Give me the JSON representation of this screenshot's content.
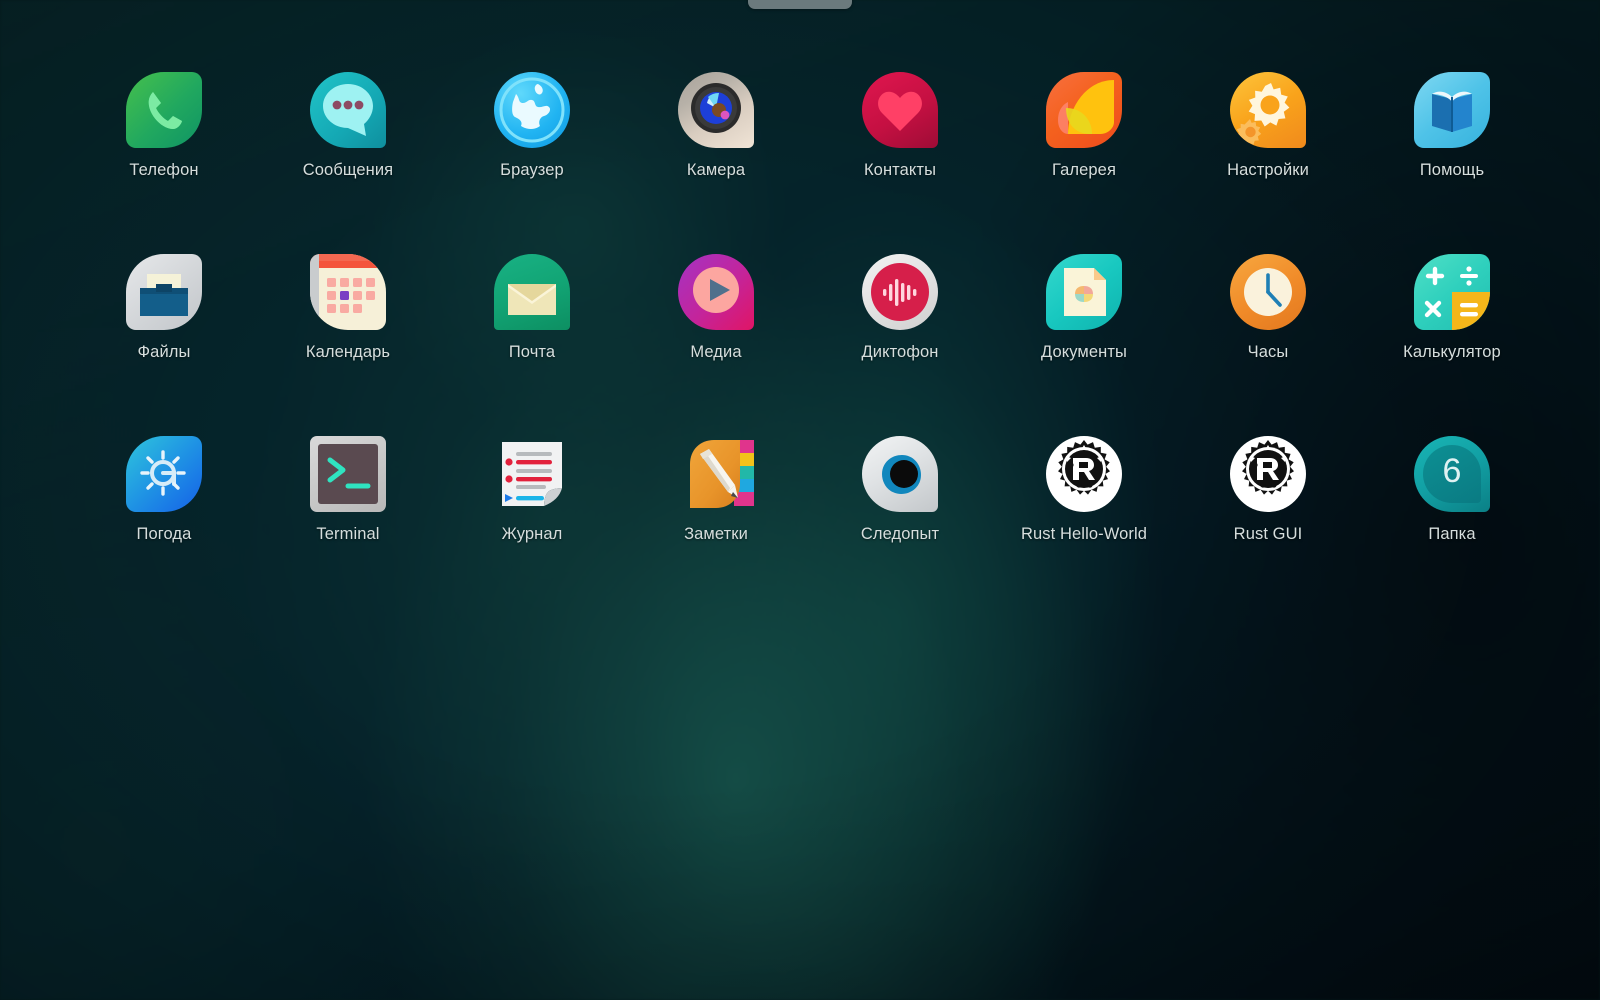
{
  "screen": {
    "type": "mobile-app-launcher",
    "background_color": "#06262a",
    "label_color": "#d6dedd",
    "handle_color": "#6b7a7d",
    "handle_name": "drawer-handle"
  },
  "apps": [
    {
      "label": "Телефон",
      "icon": "phone-icon",
      "shape": "leaf",
      "color": "#3fbf63"
    },
    {
      "label": "Сообщения",
      "icon": "messages-icon",
      "shape": "drop",
      "color": "#1fb6bd"
    },
    {
      "label": "Браузер",
      "icon": "browser-icon",
      "shape": "circle",
      "color": "#19b6f0"
    },
    {
      "label": "Камера",
      "icon": "camera-icon",
      "shape": "drop",
      "color": "#b9b2a8"
    },
    {
      "label": "Контакты",
      "icon": "contacts-icon",
      "shape": "drop",
      "color": "#d8204a"
    },
    {
      "label": "Галерея",
      "icon": "gallery-icon",
      "shape": "leaf",
      "color": "#f4611e"
    },
    {
      "label": "Настройки",
      "icon": "settings-icon",
      "shape": "drop",
      "color": "#f9a31b"
    },
    {
      "label": "Помощь",
      "icon": "help-icon",
      "shape": "leaf",
      "color": "#1e7fc0"
    },
    {
      "label": "Файлы",
      "icon": "files-icon",
      "shape": "leaf",
      "color": "#cfd2d4"
    },
    {
      "label": "Календарь",
      "icon": "calendar-icon",
      "shape": "leafalt",
      "color": "#f4efd9"
    },
    {
      "label": "Почта",
      "icon": "mail-icon",
      "shape": "arch",
      "color": "#12a575"
    },
    {
      "label": "Медиа",
      "icon": "media-icon",
      "shape": "drop",
      "color": "#c02a92"
    },
    {
      "label": "Диктофон",
      "icon": "voicerecorder-icon",
      "shape": "circle",
      "color": "#d61f4a"
    },
    {
      "label": "Документы",
      "icon": "documents-icon",
      "shape": "leaf",
      "color": "#18c8c0"
    },
    {
      "label": "Часы",
      "icon": "clock-icon",
      "shape": "circle",
      "color": "#f08a28"
    },
    {
      "label": "Калькулятор",
      "icon": "calculator-icon",
      "shape": "leaf",
      "color": "#2fd0bd"
    },
    {
      "label": "Погода",
      "icon": "weather-icon",
      "shape": "leaf",
      "color": "#1878e8"
    },
    {
      "label": "Terminal",
      "icon": "terminal-icon",
      "shape": "square",
      "color": "#c7c7c7"
    },
    {
      "label": "Журнал",
      "icon": "journal-icon",
      "shape": "page",
      "color": "#e9eaec"
    },
    {
      "label": "Заметки",
      "icon": "notes-icon",
      "shape": "leaf",
      "color": "#e8942a"
    },
    {
      "label": "Следопыт",
      "icon": "tracker-eye-icon",
      "shape": "drop",
      "color": "#d8dbdd"
    },
    {
      "label": "Rust Hello-World",
      "icon": "rust-icon",
      "shape": "circle",
      "color": "#ffffff"
    },
    {
      "label": "Rust GUI",
      "icon": "rust-icon",
      "shape": "circle",
      "color": "#ffffff"
    },
    {
      "label": "Папка",
      "icon": "folder-icon",
      "shape": "drop",
      "color": "#0e8f93",
      "badge": "6"
    }
  ]
}
